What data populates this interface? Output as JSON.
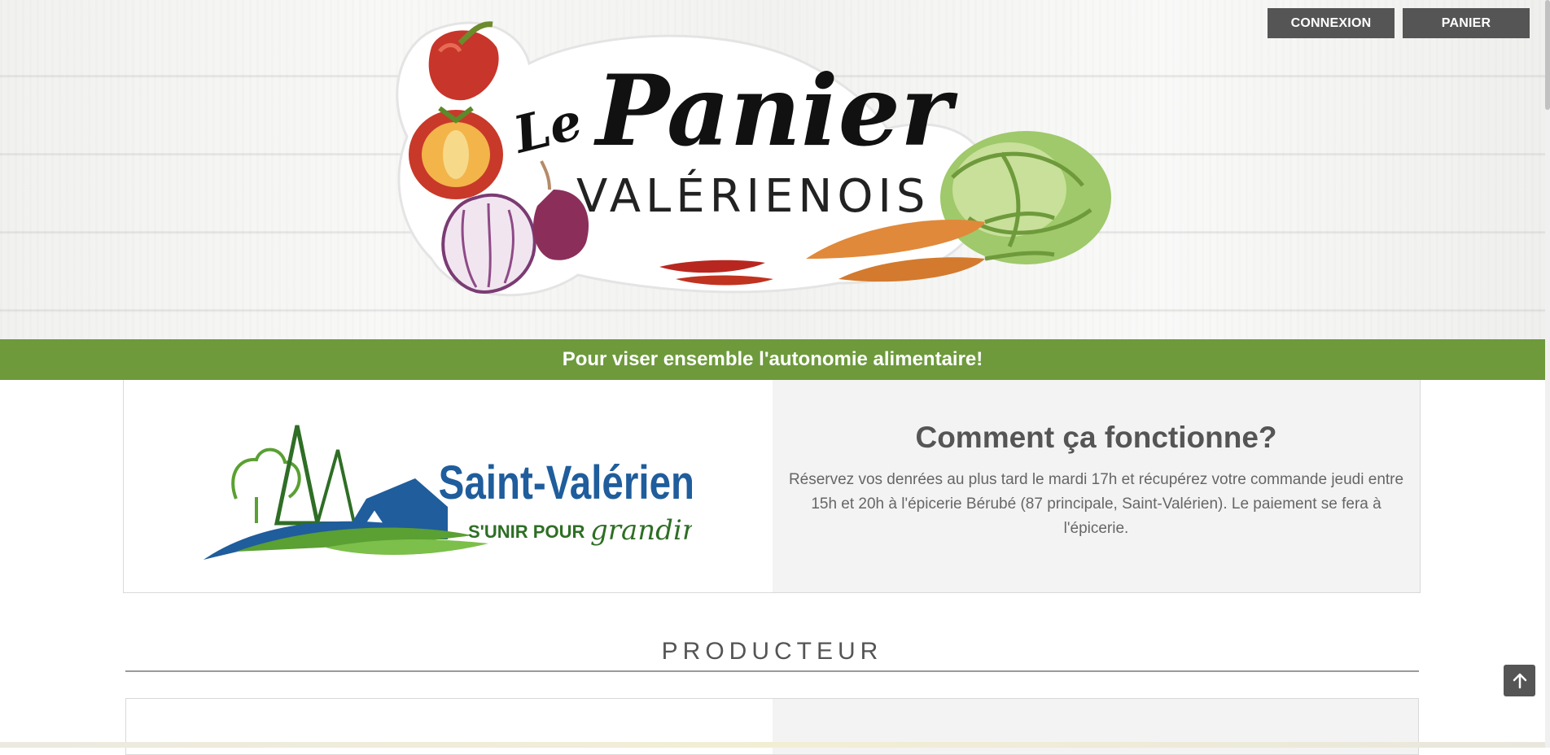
{
  "header": {
    "login_label": "CONNEXION",
    "cart_label": "PANIER",
    "logo": {
      "script_text": "Panier",
      "prefix_text": "Le",
      "subtitle_text": "VALÉRIENOIS"
    }
  },
  "banner": {
    "tagline": "Pour viser ensemble l'autonomie alimentaire!"
  },
  "info": {
    "municipality_logo": {
      "name_text": "Saint-Valérien",
      "slogan_text": "S'UNIR POUR",
      "slogan_script_text": "grandir!"
    },
    "title": "Comment ça fonctionne?",
    "body": "Réservez vos denrées au plus tard le mardi 17h et récupérez votre commande jeudi entre 15h et 20h à l'épicerie Bérubé (87 principale, Saint-Valérien). Le paiement se fera à l'épicerie."
  },
  "producer_section": {
    "title": "PRODUCTEUR"
  },
  "colors": {
    "banner_green": "#6e9a3c",
    "button_gray": "#555555",
    "panel_gray": "#f3f3f3",
    "sv_blue": "#1f5d9c",
    "sv_green": "#5aa032"
  },
  "icons": {
    "back_to_top": "arrow-up-icon"
  }
}
